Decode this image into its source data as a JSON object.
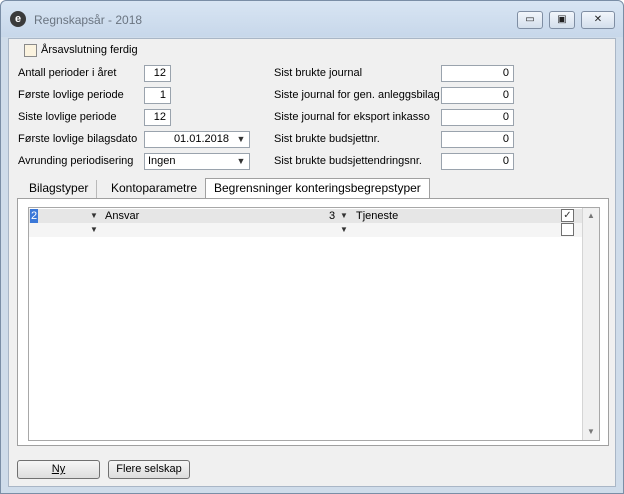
{
  "window": {
    "title": "Regnskapsår - 2018",
    "app_icon_glyph": "e",
    "controls": {
      "minimize": "▭",
      "restore": "▣",
      "close": "✕"
    }
  },
  "year_end": {
    "label": "Årsavslutning ferdig",
    "checked": false
  },
  "left_fields": {
    "periods_label": "Antall perioder i året",
    "periods_value": "12",
    "first_period_label": "Første lovlige periode",
    "first_period_value": "1",
    "last_period_label": "Siste lovlige periode",
    "last_period_value": "12",
    "first_date_label": "Første lovlige bilagsdato",
    "first_date_value": "01.01.2018",
    "rounding_label": "Avrunding periodisering",
    "rounding_value": "Ingen"
  },
  "right_fields": {
    "last_journal_label": "Sist brukte journal",
    "last_journal_value": "0",
    "last_asset_label": "Siste journal for gen. anleggsbilag",
    "last_asset_value": "0",
    "last_export_label": "Siste journal for eksport inkasso",
    "last_export_value": "0",
    "last_budget_label": "Sist brukte budsjettnr.",
    "last_budget_value": "0",
    "last_budget_change_label": "Sist brukte budsjettendringsnr.",
    "last_budget_change_value": "0"
  },
  "tabs": [
    {
      "label": "Bilagstyper"
    },
    {
      "label": "Kontoparametre"
    },
    {
      "label": "Begrensninger konteringsbegrepstyper"
    }
  ],
  "grid": {
    "rows": [
      {
        "col1": "2",
        "col2": "Ansvar",
        "col3": "3",
        "col4": "Tjeneste",
        "checked": true
      },
      {
        "col1": "",
        "col2": "",
        "col3": "",
        "col4": "",
        "checked": false
      }
    ]
  },
  "buttons": {
    "new_label": "Ny",
    "more_label": "Flere selskap"
  },
  "icons": {
    "dropdown": "chevron-down-icon",
    "check": "check-icon"
  },
  "colors": {
    "accent": "#3b78d8",
    "titlebar": "#cfdcea"
  }
}
